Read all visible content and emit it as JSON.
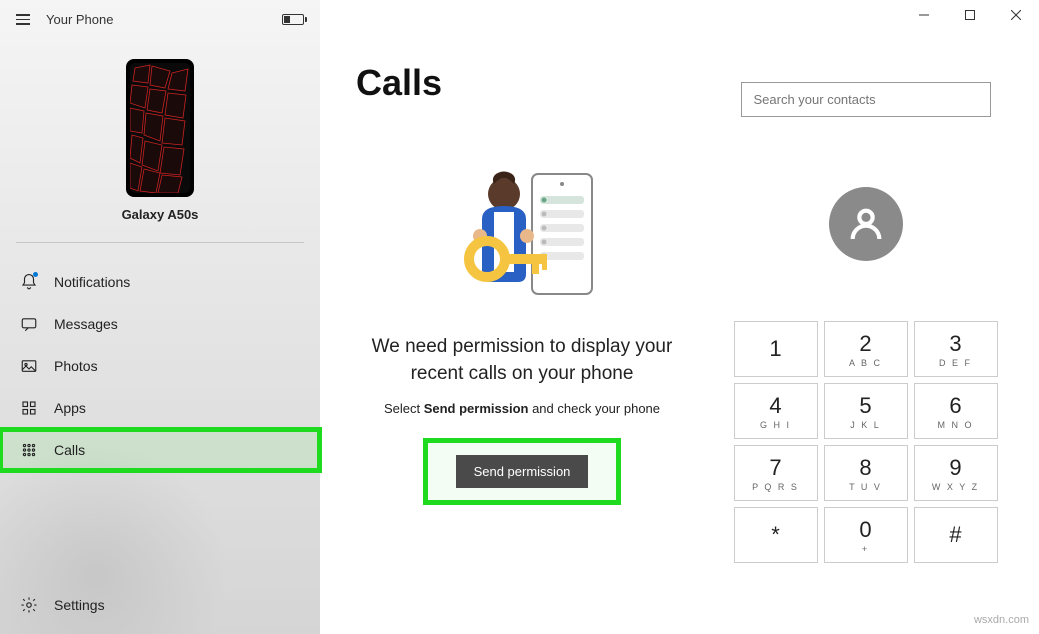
{
  "app": {
    "title": "Your Phone"
  },
  "device": {
    "name": "Galaxy A50s"
  },
  "nav": {
    "notifications": "Notifications",
    "messages": "Messages",
    "photos": "Photos",
    "apps": "Apps",
    "calls": "Calls",
    "settings": "Settings"
  },
  "calls": {
    "title": "Calls",
    "permission_title": "We need permission to display your recent calls on your phone",
    "permission_sub_pre": "Select ",
    "permission_sub_bold": "Send permission",
    "permission_sub_post": " and check your phone",
    "send_button": "Send permission"
  },
  "search": {
    "placeholder": "Search your contacts"
  },
  "dialpad": [
    {
      "num": "1",
      "letters": ""
    },
    {
      "num": "2",
      "letters": "A B C"
    },
    {
      "num": "3",
      "letters": "D E F"
    },
    {
      "num": "4",
      "letters": "G H I"
    },
    {
      "num": "5",
      "letters": "J K L"
    },
    {
      "num": "6",
      "letters": "M N O"
    },
    {
      "num": "7",
      "letters": "P Q R S"
    },
    {
      "num": "8",
      "letters": "T U V"
    },
    {
      "num": "9",
      "letters": "W X Y Z"
    },
    {
      "num": "*",
      "letters": ""
    },
    {
      "num": "0",
      "letters": "+"
    },
    {
      "num": "#",
      "letters": ""
    }
  ],
  "watermark": "wsxdn.com"
}
